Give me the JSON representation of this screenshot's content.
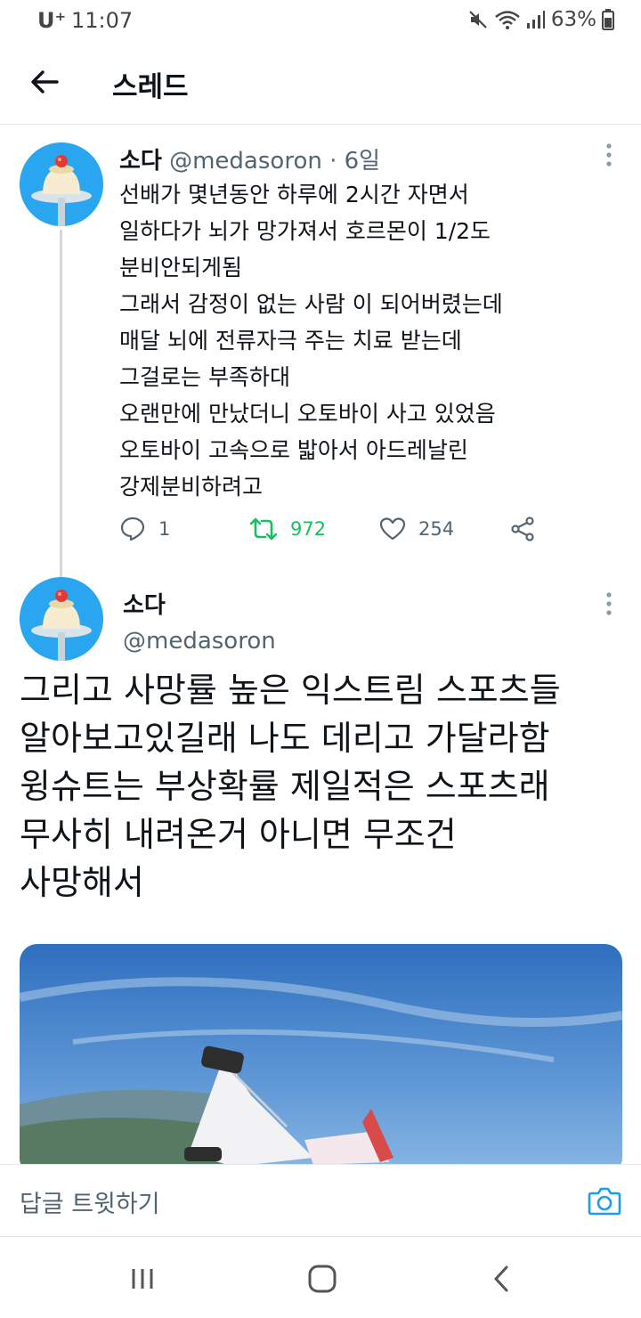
{
  "status_bar": {
    "carrier": "U⁺",
    "time": "11:07",
    "battery": "63%"
  },
  "header": {
    "title": "스레드"
  },
  "tweet1": {
    "name": "소다",
    "handle": "@medasoron",
    "separator": "·",
    "time_ago": "6일",
    "lines": [
      "선배가 몇년동안 하루에 2시간 자면서",
      "일하다가 뇌가 망가져서 호르몬이 1/2도",
      "분비안되게됨",
      "그래서 감정이 없는 사람 이 되어버렸는데",
      "매달 뇌에 전류자극 주는 치료 받는데",
      "그걸로는 부족하대",
      "오랜만에 만났더니 오토바이 사고 있었음",
      "오토바이 고속으로 밟아서 아드레날린",
      "강제분비하려고"
    ],
    "reply_count": "1",
    "retweet_count": "972",
    "like_count": "254"
  },
  "tweet2": {
    "name": "소다",
    "handle": "@medasoron",
    "lines": [
      "그리고 사망률 높은 익스트림 스포츠들",
      "알아보고있길래 나도 데리고 가달라함",
      "윙슈트는 부상확률 제일적은 스포츠래",
      "무사히 내려온거 아니면 무조건",
      "사망해서"
    ]
  },
  "reply_bar": {
    "placeholder": "답글 트윗하기"
  },
  "colors": {
    "retweet_active": "#17bf63",
    "secondary_text": "#536471",
    "accent": "#1d9bf0"
  }
}
